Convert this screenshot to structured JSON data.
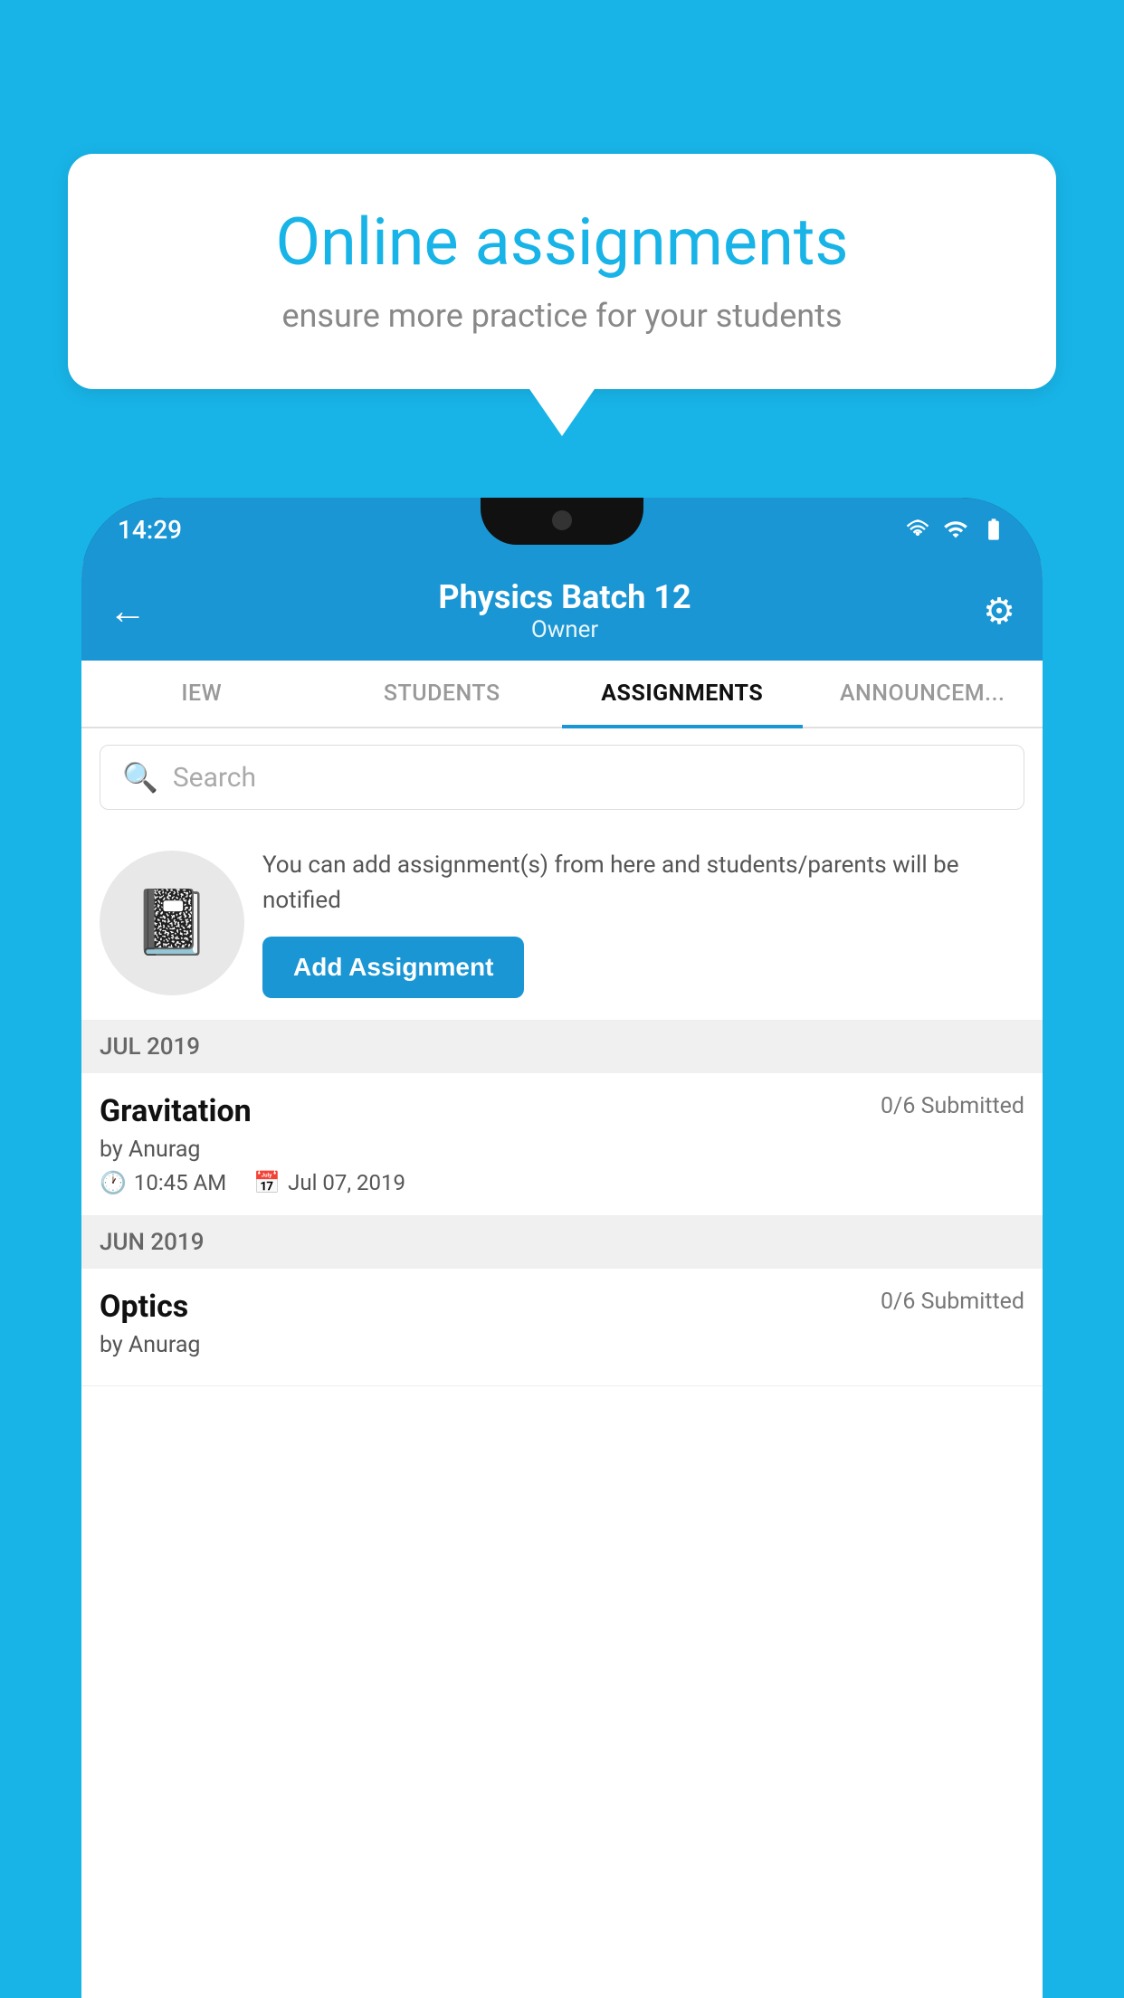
{
  "background_color": "#18b4e8",
  "speech_bubble": {
    "title": "Online assignments",
    "subtitle": "ensure more practice for your students"
  },
  "phone": {
    "status_bar": {
      "time": "14:29",
      "icons": [
        "wifi",
        "signal",
        "battery"
      ]
    },
    "header": {
      "title": "Physics Batch 12",
      "subtitle": "Owner",
      "back_label": "←",
      "settings_icon": "⚙"
    },
    "tabs": [
      {
        "label": "IEW",
        "active": false
      },
      {
        "label": "STUDENTS",
        "active": false
      },
      {
        "label": "ASSIGNMENTS",
        "active": true
      },
      {
        "label": "ANNOUNCEM...",
        "active": false
      }
    ],
    "search": {
      "placeholder": "Search"
    },
    "promo": {
      "text": "You can add assignment(s) from here and students/parents will be notified",
      "button_label": "Add Assignment"
    },
    "sections": [
      {
        "header": "JUL 2019",
        "assignments": [
          {
            "name": "Gravitation",
            "submitted": "0/6 Submitted",
            "by": "by Anurag",
            "time": "10:45 AM",
            "date": "Jul 07, 2019"
          }
        ]
      },
      {
        "header": "JUN 2019",
        "assignments": [
          {
            "name": "Optics",
            "submitted": "0/6 Submitted",
            "by": "by Anurag",
            "time": "",
            "date": ""
          }
        ]
      }
    ]
  }
}
